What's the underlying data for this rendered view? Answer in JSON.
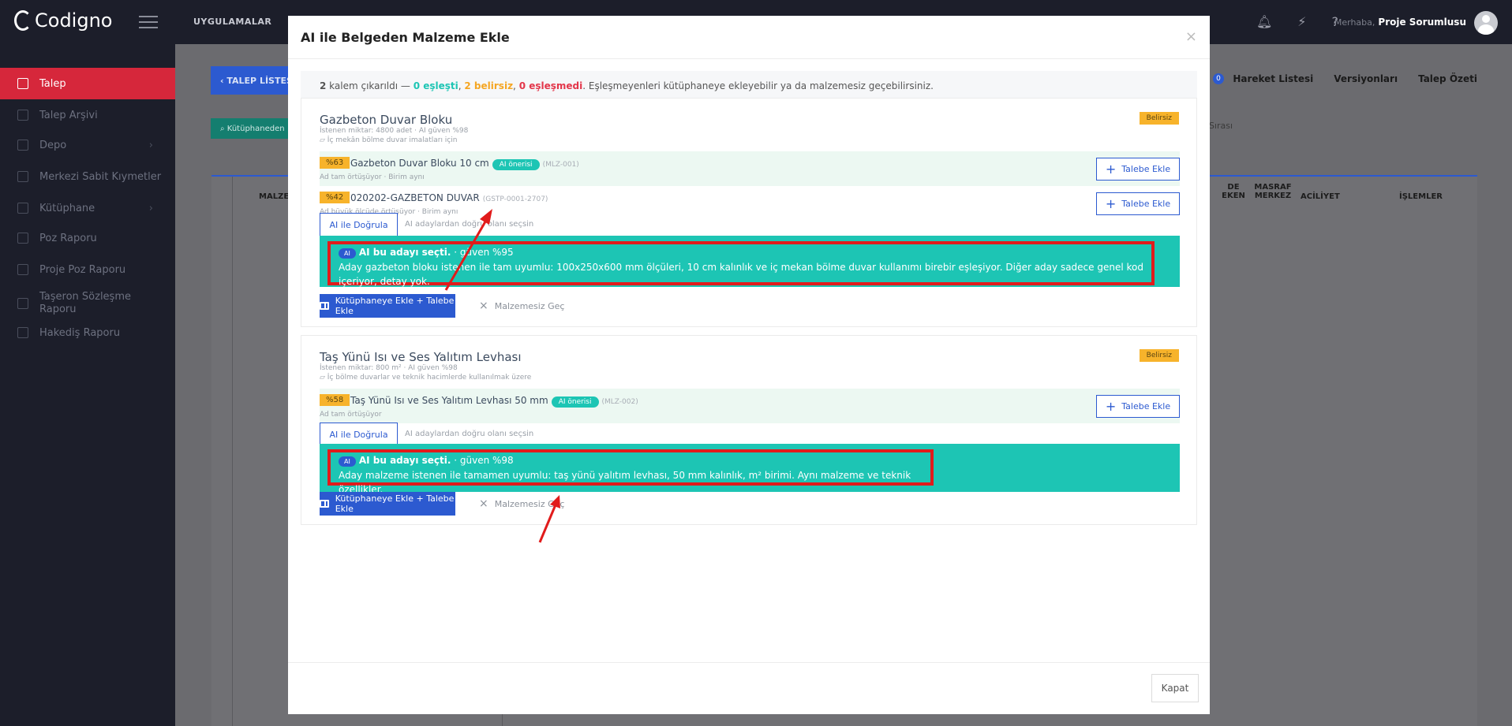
{
  "app": {
    "brand": "Codigno",
    "apps_label": "UYGULAMALAR",
    "greeting": "Merhaba,",
    "user": "Proje Sorumlusu"
  },
  "sidebar": {
    "items": [
      {
        "label": "Talep"
      },
      {
        "label": "Talep Arşivi"
      },
      {
        "label": "Depo"
      },
      {
        "label": "Merkezi Sabit Kıymetler"
      },
      {
        "label": "Kütüphane"
      },
      {
        "label": "Poz Raporu"
      },
      {
        "label": "Proje Poz Raporu"
      },
      {
        "label": "Taşeron Sözleşme Raporu"
      },
      {
        "label": "Hakediş Raporu"
      }
    ]
  },
  "background": {
    "back_button": "TALEP LİSTESİ",
    "library_button": "Kütüphaneden",
    "links": [
      "Hareket Listesi",
      "Versiyonları",
      "Talep Özeti"
    ],
    "badge": "0",
    "sira": "Sırası",
    "columns": [
      "MALZE",
      "DE EKEN",
      "MASRAF MERKEZ",
      "ACİLİYET",
      "İŞLEMLER"
    ]
  },
  "modal": {
    "title": "AI ile Belgeden Malzeme Ekle",
    "summary": {
      "count": "2",
      "text1": " kalem çıkarıldı — ",
      "matched": "0 eşleşti",
      "sep1": ", ",
      "uncertain": "2 belirsiz",
      "sep2": ", ",
      "unmatched": "0 eşleşmedi",
      "text2": ". Eşleşmeyenleri kütüphaneye ekleyebilir ya da malzemesiz geçebilirsiniz."
    },
    "cards": [
      {
        "title": "Gazbeton Duvar Bloku",
        "status": "Belirsiz",
        "meta1": "İstenen miktar: 4800 adet · AI güven %98",
        "meta2": "İç mekân bölme duvar imalatları için",
        "candidates": [
          {
            "pct": "%63",
            "name": "Gazbeton Duvar Bloku 10 cm",
            "ai_chip": "AI önerisi",
            "code": "(MLZ-001)",
            "sub": "Ad tam örtüşüyor · Birim aynı",
            "add": "Talebe Ekle"
          },
          {
            "pct": "%42",
            "name": "020202-GAZBETON DUVAR",
            "code": "(GSTP-0001-2707)",
            "sub": "Ad büyük ölçüde örtüşüyor · Birim aynı",
            "add": "Talebe Ekle"
          }
        ],
        "verify": "AI ile Doğrula",
        "verify_hint": "AI adaylardan doğru olanı seçsin",
        "ai_tag": "AI",
        "ai_head": "AI bu adayı seçti.",
        "ai_conf": " · güven %95",
        "ai_text": "Aday gazbeton bloku istenen ile tam uyumlu: 100x250x600 mm ölçüleri, 10 cm kalınlık ve iç mekan bölme duvar kullanımı birebir eşleşiyor. Diğer aday sadece genel kod içeriyor, detay yok.",
        "lib_button": "Kütüphaneye Ekle + Talebe Ekle",
        "skip": "Malzemesiz Geç"
      },
      {
        "title": "Taş Yünü Isı ve Ses Yalıtım Levhası",
        "status": "Belirsiz",
        "meta1": "İstenen miktar: 800 m² · AI güven %98",
        "meta2": "İç bölme duvarlar ve teknik hacimlerde kullanılmak üzere",
        "candidates": [
          {
            "pct": "%58",
            "name": "Taş Yünü Isı ve Ses Yalıtım Levhası 50 mm",
            "ai_chip": "AI önerisi",
            "code": "(MLZ-002)",
            "sub": "Ad tam örtüşüyor",
            "add": "Talebe Ekle"
          }
        ],
        "verify": "AI ile Doğrula",
        "verify_hint": "AI adaylardan doğru olanı seçsin",
        "ai_tag": "AI",
        "ai_head": "AI bu adayı seçti.",
        "ai_conf": " · güven %98",
        "ai_text": "Aday malzeme istenen ile tamamen uyumlu: taş yünü yalıtım levhası, 50 mm kalınlık, m² birimi. Aynı malzeme ve teknik özellikler.",
        "lib_button": "Kütüphaneye Ekle + Talebe Ekle",
        "skip": "Malzemesiz Geç"
      }
    ],
    "close_button": "Kapat"
  }
}
